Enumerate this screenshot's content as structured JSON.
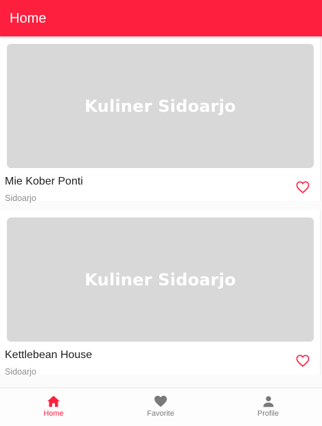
{
  "app_bar": {
    "title": "Home"
  },
  "cards": [
    {
      "image_text": "Kuliner Sidoarjo",
      "title": "Mie Kober Ponti",
      "location": "Sidoarjo",
      "favorite_icon": "heart-outline-icon"
    },
    {
      "image_text": "Kuliner Sidoarjo",
      "title": "Kettlebean House",
      "location": "Sidoarjo",
      "favorite_icon": "heart-outline-icon"
    }
  ],
  "bottom_nav": {
    "items": [
      {
        "label": "Home",
        "icon": "home-icon",
        "active": true
      },
      {
        "label": "Favorite",
        "icon": "heart-icon",
        "active": false
      },
      {
        "label": "Profile",
        "icon": "person-icon",
        "active": false
      }
    ]
  },
  "colors": {
    "primary": "#fe1f3f",
    "inactive_nav": "#7a7a7a",
    "image_placeholder": "#d8d8d8"
  }
}
